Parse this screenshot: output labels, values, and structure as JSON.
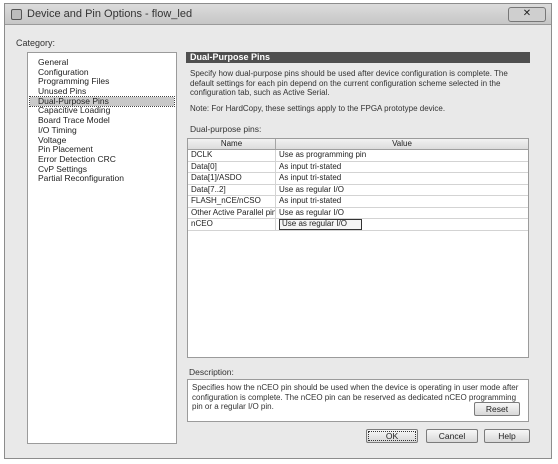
{
  "window": {
    "title": "Device and Pin Options - flow_led",
    "close_label": "✕"
  },
  "category": {
    "label": "Category:",
    "items": [
      {
        "label": "General",
        "selected": false
      },
      {
        "label": "Configuration",
        "selected": false
      },
      {
        "label": "Programming Files",
        "selected": false
      },
      {
        "label": "Unused Pins",
        "selected": false
      },
      {
        "label": "Dual-Purpose Pins",
        "selected": true
      },
      {
        "label": "Capacitive Loading",
        "selected": false
      },
      {
        "label": "Board Trace Model",
        "selected": false
      },
      {
        "label": "I/O Timing",
        "selected": false
      },
      {
        "label": "Voltage",
        "selected": false
      },
      {
        "label": "Pin Placement",
        "selected": false
      },
      {
        "label": "Error Detection CRC",
        "selected": false
      },
      {
        "label": "CvP Settings",
        "selected": false
      },
      {
        "label": "Partial Reconfiguration",
        "selected": false
      }
    ]
  },
  "panel": {
    "header": "Dual-Purpose Pins",
    "description": "Specify how dual-purpose pins should be used after device configuration is complete. The default settings for each pin depend on the current configuration scheme selected in the configuration tab, such as   Active Serial.",
    "note": "Note: For HardCopy, these settings apply to the FPGA prototype device.",
    "pins_label": "Dual-purpose pins:",
    "columns": {
      "name": "Name",
      "value": "Value"
    },
    "rows": [
      {
        "name": "DCLK",
        "value": "Use as programming pin",
        "editing": false
      },
      {
        "name": "Data[0]",
        "value": "As input tri-stated",
        "editing": false
      },
      {
        "name": "Data[1]/ASDO",
        "value": "As input tri-stated",
        "editing": false
      },
      {
        "name": "Data[7..2]",
        "value": "Use as regular I/O",
        "editing": false
      },
      {
        "name": "FLASH_nCE/nCSO",
        "value": "As input tri-stated",
        "editing": false
      },
      {
        "name": "Other Active Parallel pins",
        "value": "Use as regular I/O",
        "editing": false
      },
      {
        "name": "nCEO",
        "value": "Use as regular I/O",
        "editing": true
      }
    ],
    "description_label": "Description:",
    "description_text": "Specifies how the nCEO pin should be used when the device is operating in user mode after configuration is complete. The nCEO pin can be reserved as dedicated nCEO programming pin or a regular I/O pin."
  },
  "buttons": {
    "reset": "Reset",
    "ok": "OK",
    "cancel": "Cancel",
    "help": "Help"
  }
}
